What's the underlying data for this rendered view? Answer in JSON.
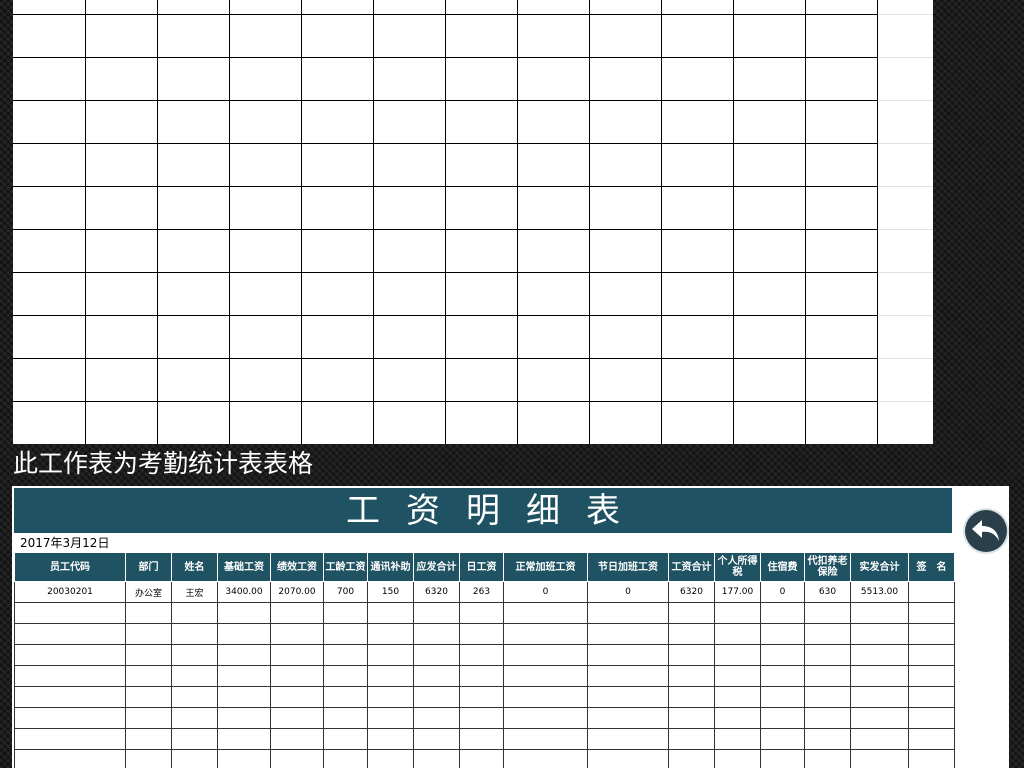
{
  "caption": "此工作表为考勤统计表表格",
  "colors": {
    "header_bg": "#1f5262",
    "page_bg": "#1b1b1b"
  },
  "payroll": {
    "title": "工资明细表",
    "date": "2017年3月12日",
    "columns": [
      "员工代码",
      "部门",
      "姓名",
      "基础工资",
      "绩效工资",
      "工龄工资",
      "通讯补助",
      "应发合计",
      "日工资",
      "正常加班工资",
      "节日加班工资",
      "工资合计",
      "个人所得税",
      "住宿费",
      "代扣养老保险",
      "实发合计",
      "签　名"
    ],
    "rows": [
      [
        "20030201",
        "办公室",
        "王宏",
        "3400.00",
        "2070.00",
        "700",
        "150",
        "6320",
        "263",
        "0",
        "0",
        "6320",
        "177.00",
        "0",
        "630",
        "5513.00",
        ""
      ]
    ]
  },
  "icons": {
    "back": "back-arrow-icon"
  }
}
